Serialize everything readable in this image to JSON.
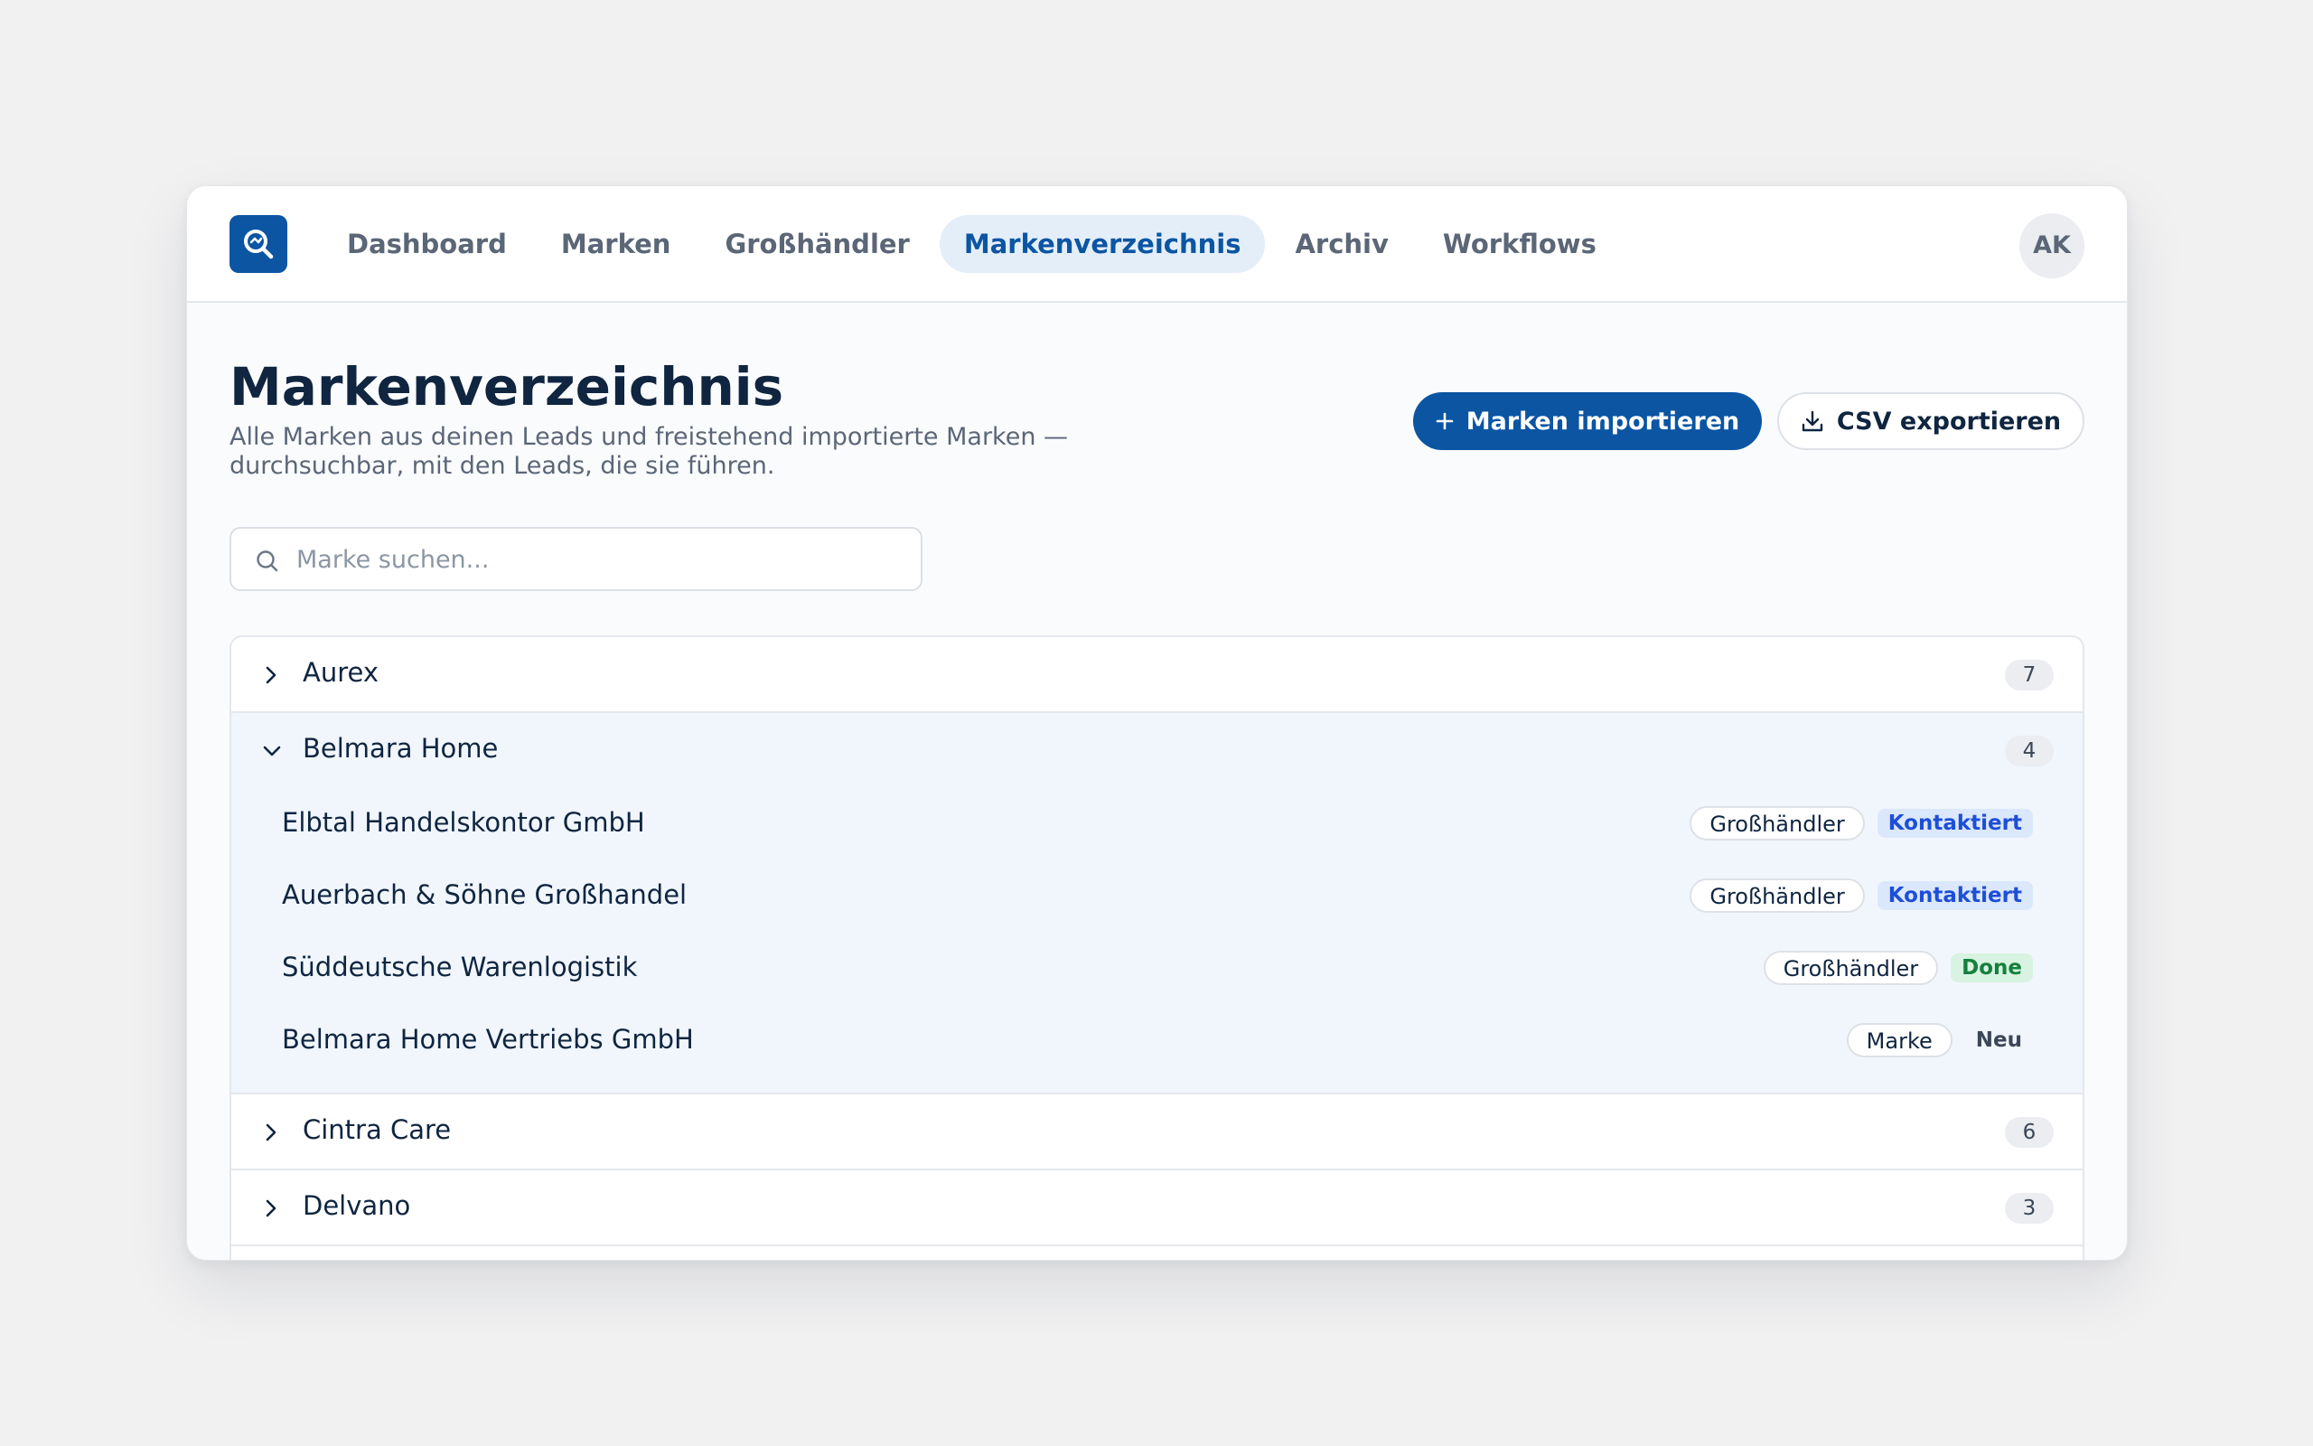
{
  "nav": {
    "items": [
      {
        "label": "Dashboard"
      },
      {
        "label": "Marken"
      },
      {
        "label": "Großhändler"
      },
      {
        "label": "Markenverzeichnis",
        "active": true
      },
      {
        "label": "Archiv"
      },
      {
        "label": "Workflows"
      }
    ],
    "user_initials": "AK"
  },
  "page": {
    "title": "Markenverzeichnis",
    "subtitle": "Alle Marken aus deinen Leads und freistehend importierte Marken — durchsuchbar, mit den Leads, die sie führen."
  },
  "actions": {
    "import_label": "Marken importieren",
    "export_label": "CSV exportieren"
  },
  "search": {
    "placeholder": "Marke suchen...",
    "value": ""
  },
  "colors": {
    "accent": "#0b55a3",
    "status_kontaktiert": "#1d4ed8",
    "status_done": "#15803d",
    "status_neu": "#3b4656"
  },
  "brands": [
    {
      "name": "Aurex",
      "count": "7",
      "expanded": false
    },
    {
      "name": "Belmara Home",
      "count": "4",
      "expanded": true,
      "leads": [
        {
          "name": "Elbtal Handelskontor GmbH",
          "type": "Großhändler",
          "status": "Kontaktiert"
        },
        {
          "name": "Auerbach & Söhne Großhandel",
          "type": "Großhändler",
          "status": "Kontaktiert"
        },
        {
          "name": "Süddeutsche Warenlogistik",
          "type": "Großhändler",
          "status": "Done"
        },
        {
          "name": "Belmara Home Vertriebs GmbH",
          "type": "Marke",
          "status": "Neu"
        }
      ]
    },
    {
      "name": "Cintra Care",
      "count": "6",
      "expanded": false
    },
    {
      "name": "Delvano",
      "count": "3",
      "expanded": false
    }
  ]
}
